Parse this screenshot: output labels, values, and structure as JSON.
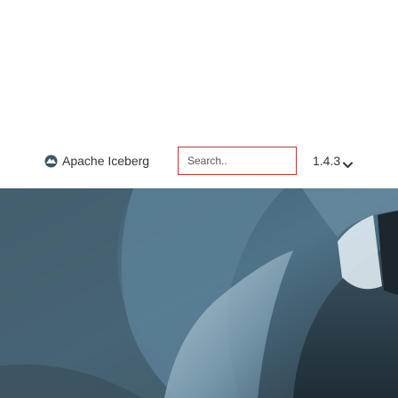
{
  "header": {
    "brand_label": "Apache Iceberg",
    "search": {
      "placeholder": "Search..",
      "value": ""
    },
    "version_label": "1.4.3"
  },
  "icons": {
    "brand_logo": "iceberg-logo-icon",
    "version_dropdown": "chevron-down-icon"
  },
  "colors": {
    "search_border": "#c0392b",
    "hero_dark": "#2e3f4a",
    "hero_mid": "#4b7086",
    "hero_light": "#8fb1c0",
    "text": "#333333"
  }
}
